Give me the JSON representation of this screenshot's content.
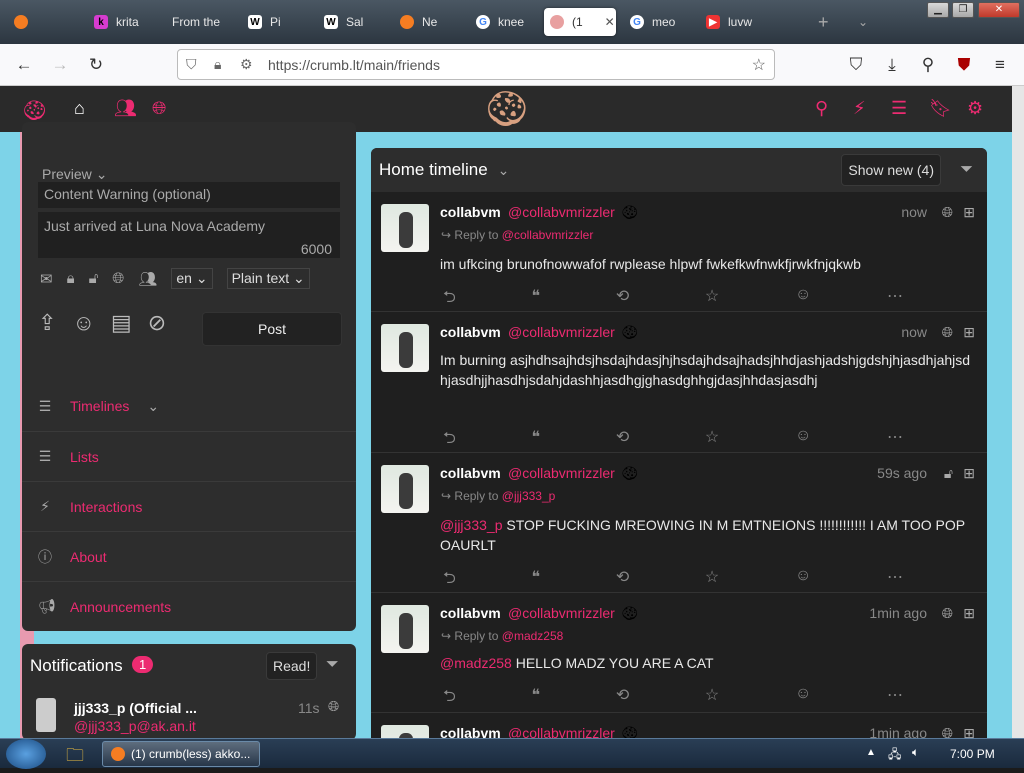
{
  "browser": {
    "tabs": [
      {
        "label": "krita",
        "active": false
      },
      {
        "label": "From the",
        "active": false
      },
      {
        "label": "Pi",
        "active": false
      },
      {
        "label": "Sal",
        "active": false
      },
      {
        "label": "Ne",
        "active": false
      },
      {
        "label": "knee",
        "active": false
      },
      {
        "label": "(1",
        "active": true
      },
      {
        "label": "meo",
        "active": false
      },
      {
        "label": "luvw",
        "active": false
      }
    ],
    "url": "https://crumb.lt/main/friends"
  },
  "post_form": {
    "preview_label": "Preview",
    "cw_placeholder": "Content Warning (optional)",
    "text_value": "Just arrived at Luna Nova Academy",
    "char_count": "6000",
    "language": "en",
    "format": "Plain text",
    "post_label": "Post"
  },
  "sidebar": {
    "items": [
      {
        "label": "Timelines"
      },
      {
        "label": "Lists"
      },
      {
        "label": "Interactions"
      },
      {
        "label": "About"
      },
      {
        "label": "Announcements"
      }
    ]
  },
  "timeline": {
    "title": "Home timeline",
    "show_new": "Show new (4)",
    "statuses": [
      {
        "name": "collabvm",
        "handle": "@collabvmrizzler",
        "time": "now",
        "reply_label": "Reply to",
        "reply_handle": "@collabvmrizzler",
        "mention": "",
        "text": "im ufkcing brunofnowwafof rwplease hlpwf fwkefkwfnwkfjrwkfnjqkwb"
      },
      {
        "name": "collabvm",
        "handle": "@collabvmrizzler",
        "time": "now",
        "reply_label": "",
        "reply_handle": "",
        "mention": "",
        "text": "Im burning asjhdhsajhdsjhsdajhdasjhjhsdajhdsajhadsjhhdjashjadshjgdshjhjasdhjahjsdhjasdhjjhasdhjsdahjdashhjasdhgjghasdghhgjdasjhhdasjasdhj"
      },
      {
        "name": "collabvm",
        "handle": "@collabvmrizzler",
        "time": "59s ago",
        "reply_label": "Reply to",
        "reply_handle": "@jjj333_p",
        "mention": "@jjj333_p",
        "text": "STOP FUCKING MREOWING IN M EMTNEIONS !!!!!!!!!!!! I AM TOO POPOAURLT"
      },
      {
        "name": "collabvm",
        "handle": "@collabvmrizzler",
        "time": "1min ago",
        "reply_label": "Reply to",
        "reply_handle": "@madz258",
        "mention": "@madz258",
        "text": "HELLO MADZ YOU ARE A CAT"
      },
      {
        "name": "collabvm",
        "handle": "@collabvmrizzler",
        "time": "1min ago",
        "reply_label": "",
        "reply_handle": "",
        "mention": "",
        "text": ""
      }
    ]
  },
  "notifications": {
    "title": "Notifications",
    "count": "1",
    "read_label": "Read!",
    "item_name": "jjj333_p (Official ...",
    "item_handle": "@jjj333_p@ak.an.it",
    "item_time": "11s"
  },
  "taskbar": {
    "window_label": "(1) crumb(less) akko...",
    "clock": "7:00 PM"
  },
  "colors": {
    "accent": "#ec2b71",
    "panel": "#2d2d2d",
    "timeline_bg": "#1f1f1f"
  }
}
